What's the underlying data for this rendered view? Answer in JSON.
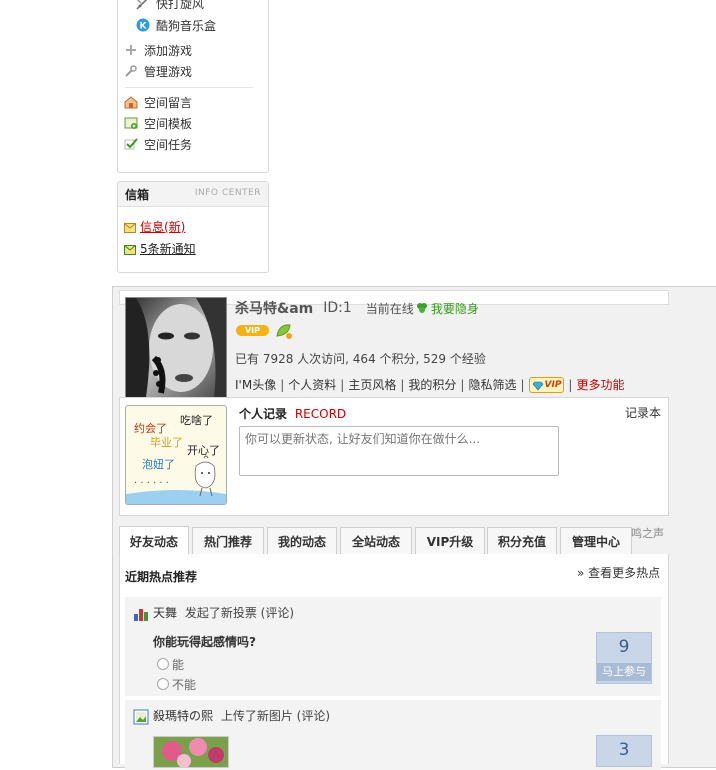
{
  "sidebar": {
    "games": [
      {
        "label": "快打旋风",
        "icon": "sword-game-icon"
      },
      {
        "label": "酷狗音乐盒",
        "icon": "kugou-music-icon"
      }
    ],
    "actions": [
      {
        "label": "添加游戏",
        "icon": "plus-icon"
      },
      {
        "label": "管理游戏",
        "icon": "wrench-icon"
      }
    ],
    "space": [
      {
        "label": "空间留言",
        "icon": "house-message-icon"
      },
      {
        "label": "空间模板",
        "icon": "template-icon"
      },
      {
        "label": "空间任务",
        "icon": "task-check-icon"
      }
    ]
  },
  "inbox": {
    "title": "信箱",
    "subtitle": "INFO CENTER",
    "messages": "信息(新)",
    "notices": "5条新通知"
  },
  "profile": {
    "name": "杀马特&am",
    "id_label": "ID:1",
    "online_label": "当前在线",
    "hide_label": "我要隐身",
    "vip_badge": "VIP",
    "stats": "已有 7928 人次访问, 464 个积分, 529 个经验",
    "links": [
      "I'M头像",
      "个人资料",
      "主页风格",
      "我的积分",
      "隐私筛选"
    ],
    "vip_link_badge": "VIP",
    "more_link": "更多功能"
  },
  "record": {
    "title": "个人记录",
    "title_en": "RECORD",
    "notebook_link": "记录本",
    "placeholder": "你可以更新状态, 让好友们知道你在做什么...",
    "doodle": {
      "yuehui": "约会了",
      "chihao": "吃啥了",
      "biye": "毕业了",
      "kaixin": "开心了",
      "paoniu": "泡妞了",
      "dots": ". . . . . ."
    }
  },
  "tabs": [
    "好友动态",
    "热门推荐",
    "我的动态",
    "全站动态",
    "VIP升级",
    "积分充值",
    "管理中心"
  ],
  "tab_side": "鸣之声",
  "feed": {
    "section_title": "近期热点推荐",
    "more_link": "» 查看更多热点",
    "items": [
      {
        "user": "天舞",
        "action": "发起了新投票 (评论)",
        "question": "你能玩得起感情吗?",
        "options": [
          "能",
          "不能"
        ],
        "count": "9",
        "button": "马上参与"
      },
      {
        "user": "殺瑪特の熙",
        "action": "上传了新图片 (评论)",
        "count": "3"
      }
    ]
  },
  "colors": {
    "accent_red": "#cc0000",
    "green": "#3a9a1a",
    "vote_blue": "#c9d6e8"
  }
}
